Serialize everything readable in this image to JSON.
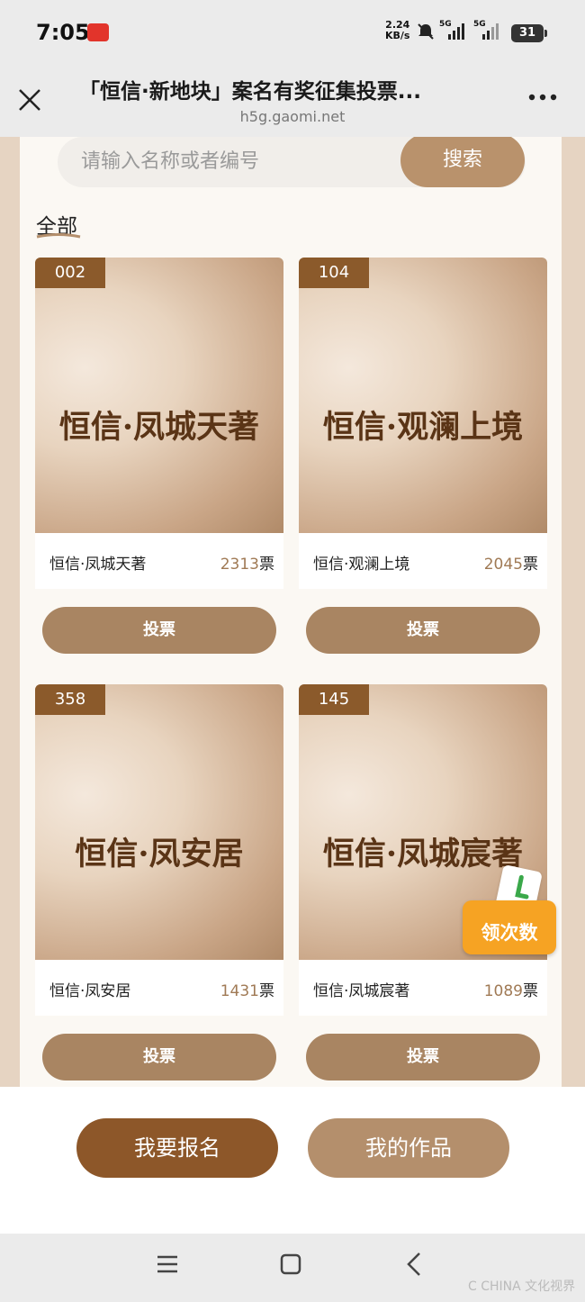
{
  "status_bar": {
    "time": "7:05",
    "net_speed_value": "2.24",
    "net_speed_unit": "KB/s",
    "signal_1_label": "5G",
    "signal_2_label": "5G",
    "battery": "31"
  },
  "title_bar": {
    "title": "「恒信·新地块」案名有奖征集投票...",
    "url": "h5g.gaomi.net",
    "more": "..."
  },
  "search": {
    "placeholder": "请输入名称或者编号",
    "button_label": "搜索"
  },
  "section": {
    "title": "全部"
  },
  "cards": [
    {
      "number": "002",
      "image_text": "恒信·凤城天著",
      "name": "恒信·凤城天著",
      "votes": "2313",
      "votes_unit": "票",
      "vote_button": "投票"
    },
    {
      "number": "104",
      "image_text": "恒信·观澜上境",
      "name": "恒信·观澜上境",
      "votes": "2045",
      "votes_unit": "票",
      "vote_button": "投票"
    },
    {
      "number": "358",
      "image_text": "恒信·凤安居",
      "name": "恒信·凤安居",
      "votes": "1431",
      "votes_unit": "票",
      "vote_button": "投票"
    },
    {
      "number": "145",
      "image_text": "恒信·凤城宸著",
      "name": "恒信·凤城宸著",
      "votes": "1089",
      "votes_unit": "票",
      "vote_button": "投票"
    }
  ],
  "floating_badge": {
    "label": "领次数"
  },
  "action_bar": {
    "register_label": "我要报名",
    "my_works_label": "我的作品"
  },
  "watermark": "C CHINA 文化视界",
  "colors": {
    "accent_dark": "#8d5729",
    "accent_light": "#b48f6c",
    "badge_orange": "#f6a323"
  }
}
